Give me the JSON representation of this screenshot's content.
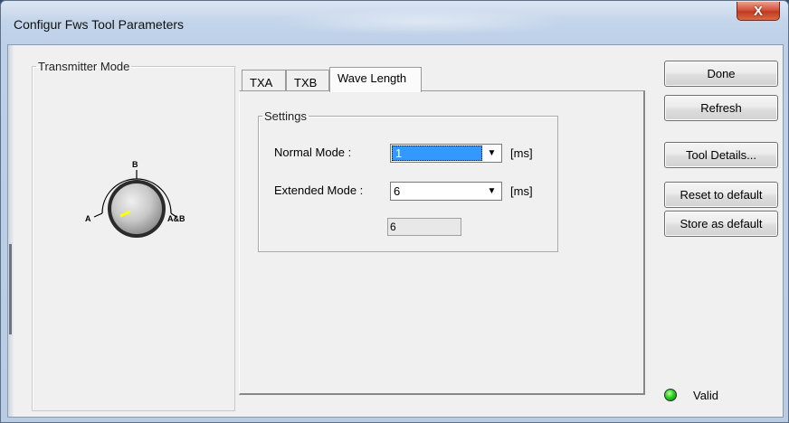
{
  "window": {
    "title": "Configur Fws Tool Parameters",
    "close_glyph": "X"
  },
  "transmitter": {
    "legend": "Transmitter Mode",
    "knob": {
      "label_a": "A",
      "label_b": "B",
      "label_ab": "A&B",
      "indicator_color": "#ffff00"
    }
  },
  "tabs": [
    {
      "label": "TXA",
      "active": false
    },
    {
      "label": "TXB",
      "active": false
    },
    {
      "label": "Wave Length",
      "active": true
    }
  ],
  "settings": {
    "legend": "Settings",
    "normal_mode": {
      "label": "Normal Mode :",
      "value": "1",
      "unit": "[ms]"
    },
    "extended_mode": {
      "label": "Extended Mode :",
      "value": "6",
      "unit": "[ms]"
    },
    "readonly_value": "6"
  },
  "buttons": {
    "done": "Done",
    "refresh": "Refresh",
    "tool_details": "Tool Details...",
    "reset_default": "Reset to default",
    "store_default": "Store as default"
  },
  "status": {
    "text": "Valid",
    "led_color": "#27d11f"
  },
  "icons": {
    "close": "close-icon",
    "dropdown": "chevron-down-icon",
    "led": "status-led-icon"
  }
}
